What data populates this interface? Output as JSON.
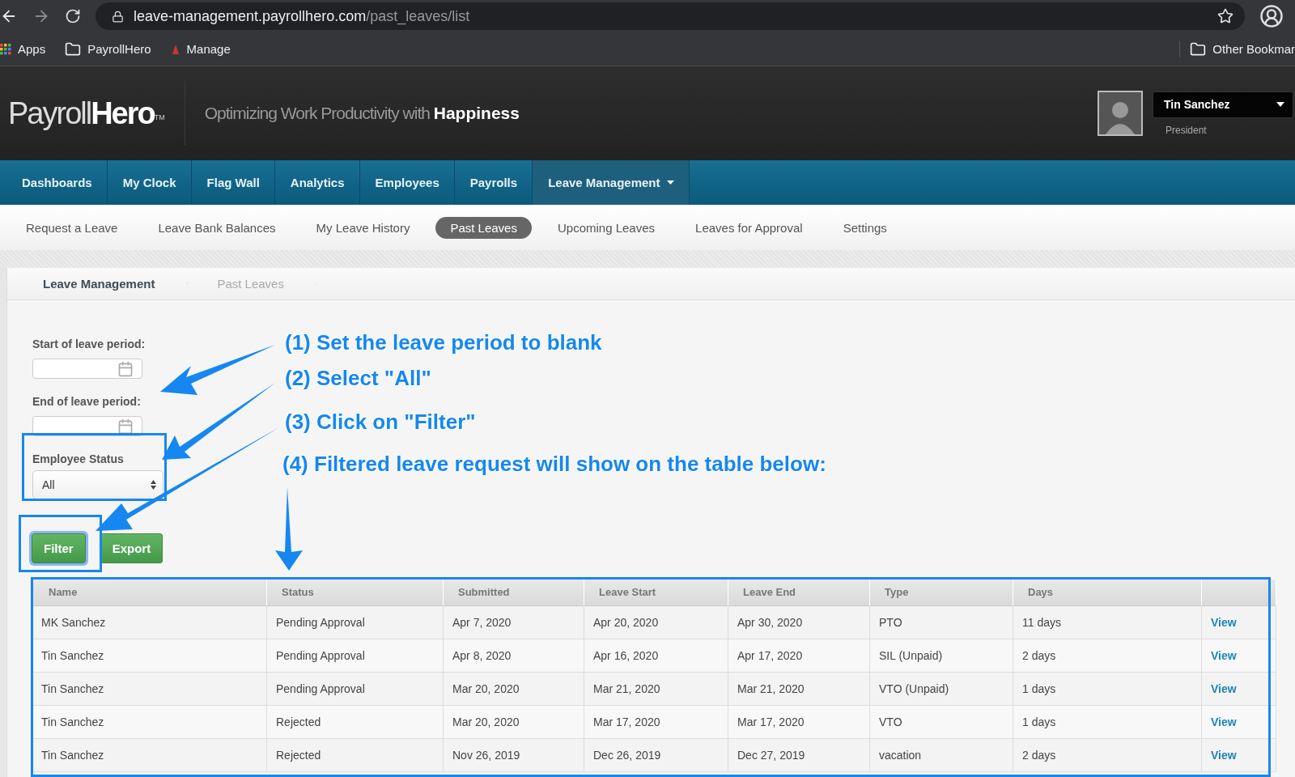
{
  "browser": {
    "url_host": "leave-management.payrollhero.com",
    "url_path": "/past_leaves/list",
    "bookmarks": [
      {
        "label": "Apps",
        "kind": "apps"
      },
      {
        "label": "PayrollHero",
        "kind": "folder"
      },
      {
        "label": "Manage",
        "kind": "site"
      }
    ],
    "other_bookmarks": "Other Bookmar"
  },
  "header": {
    "logo": "Payroll**Hero**",
    "logo_mark": "TM",
    "tagline": "Optimizing Work Productivity with **Happiness**",
    "user": {
      "name": "Tin Sanchez",
      "role": "President"
    }
  },
  "nav": [
    {
      "label": "Dashboards",
      "selected": false,
      "menu": false
    },
    {
      "label": "My Clock",
      "selected": false,
      "menu": false
    },
    {
      "label": "Flag Wall",
      "selected": false,
      "menu": false
    },
    {
      "label": "Analytics",
      "selected": false,
      "menu": false
    },
    {
      "label": "Employees",
      "selected": false,
      "menu": false
    },
    {
      "label": "Payrolls",
      "selected": false,
      "menu": false
    },
    {
      "label": "Leave Management",
      "selected": true,
      "menu": true
    }
  ],
  "subnav": [
    {
      "label": "Request a Leave",
      "selected": false
    },
    {
      "label": "Leave Bank Balances",
      "selected": false
    },
    {
      "label": "My Leave History",
      "selected": false
    },
    {
      "label": "Past Leaves",
      "selected": true
    },
    {
      "label": "Upcoming Leaves",
      "selected": false
    },
    {
      "label": "Leaves for Approval",
      "selected": false
    },
    {
      "label": "Settings",
      "selected": false
    }
  ],
  "breadcrumb": [
    {
      "label": "Leave Management",
      "current": false
    },
    {
      "label": "Past Leaves",
      "current": true
    }
  ],
  "filters": {
    "start_label": "Start of leave period:",
    "end_label": "End of leave period:",
    "status_label": "Employee Status",
    "status_value": "All",
    "buttons": [
      {
        "label": "Filter"
      },
      {
        "label": "Export"
      }
    ]
  },
  "table": {
    "columns": [
      "Name",
      "Status",
      "Submitted",
      "Leave Start",
      "Leave End",
      "Type",
      "Days"
    ],
    "rows": [
      {
        "cells": [
          "MK Sanchez",
          "Pending Approval",
          "Apr 7, 2020",
          "Apr 20, 2020",
          "Apr 30, 2020",
          "PTO",
          "11 days"
        ],
        "action": "View"
      },
      {
        "cells": [
          "Tin Sanchez",
          "Pending Approval",
          "Apr 8, 2020",
          "Apr 16, 2020",
          "Apr 17, 2020",
          "SIL (Unpaid)",
          "2 days"
        ],
        "action": "View"
      },
      {
        "cells": [
          "Tin Sanchez",
          "Pending Approval",
          "Mar 20, 2020",
          "Mar 21, 2020",
          "Mar 21, 2020",
          "VTO (Unpaid)",
          "1 days"
        ],
        "action": "View"
      },
      {
        "cells": [
          "Tin Sanchez",
          "Rejected",
          "Mar 20, 2020",
          "Mar 17, 2020",
          "Mar 17, 2020",
          "VTO",
          "1 days"
        ],
        "action": "View"
      },
      {
        "cells": [
          "Tin Sanchez",
          "Rejected",
          "Nov 26, 2019",
          "Dec 26, 2019",
          "Dec 27, 2019",
          "vacation",
          "2 days"
        ],
        "action": "View"
      }
    ]
  },
  "annotations": [
    "(1) Set the leave period to blank",
    "(2) Select \"All\"",
    "(3) Click on \"Filter\"",
    "(4) Filtered leave request will show on the table below:"
  ]
}
